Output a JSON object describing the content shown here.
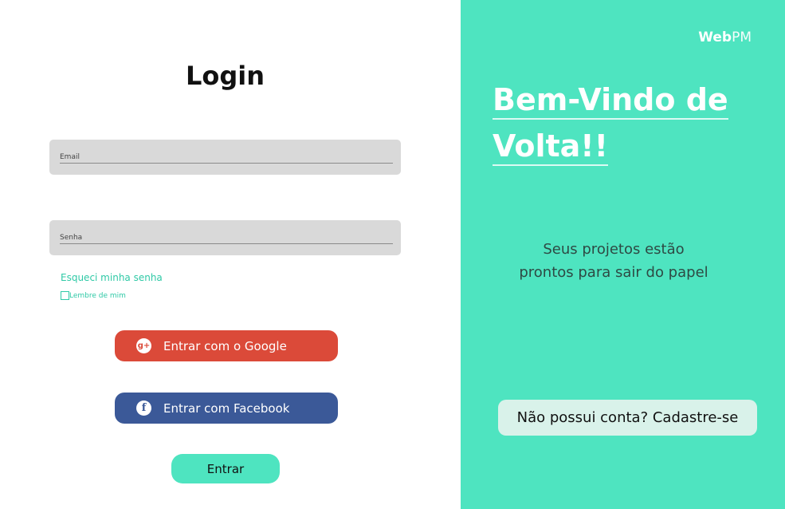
{
  "login": {
    "title": "Login",
    "email_label": "Email",
    "password_label": "Senha",
    "forgot_link": "Esqueci minha senha",
    "remember_label": "Lembre de mim",
    "google_button": "Entrar com o Google",
    "facebook_button": "Entrar com Facebook",
    "submit_button": "Entrar"
  },
  "promo": {
    "brand_bold": "Web",
    "brand_light": "PM",
    "welcome_line1": "Bem-Vindo de",
    "welcome_line2": "Volta!!",
    "tagline": "Seus projetos estão prontos para sair do papel",
    "signup_button": "Não possui conta? Cadastre-se"
  },
  "icons": {
    "google": "google-plus-icon",
    "facebook": "facebook-icon"
  },
  "colors": {
    "accent": "#4ee4c0",
    "google": "#db4a39",
    "facebook": "#3b5998",
    "field": "#d9d9d9",
    "link": "#2fc9a6"
  }
}
